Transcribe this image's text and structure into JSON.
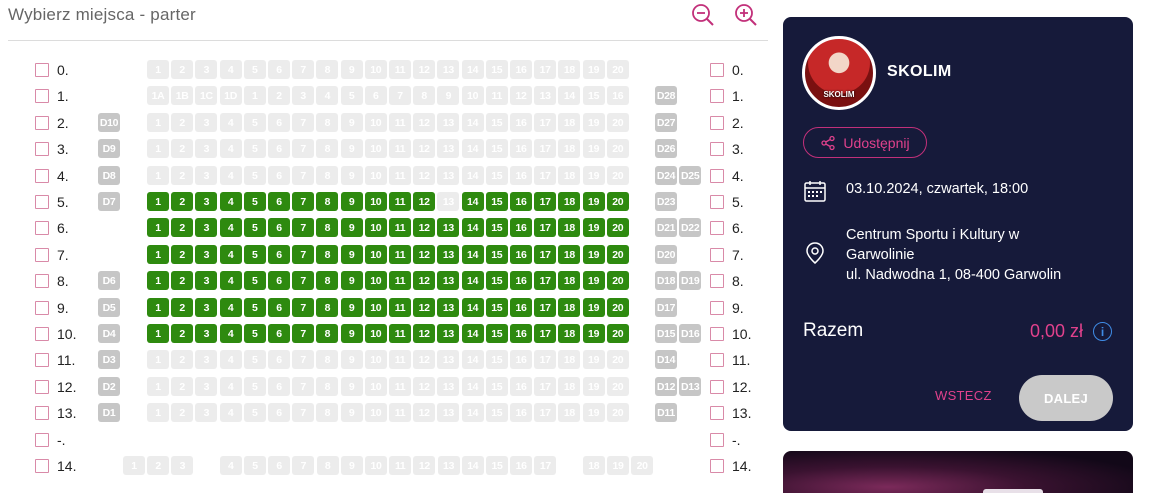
{
  "header": {
    "title": "Wybierz miejsca - parter",
    "zoom_out_icon": "zoom-out-icon",
    "zoom_in_icon": "zoom-in-icon",
    "accent": "#c2307a"
  },
  "seat_colors": {
    "free": "#ececec",
    "available": "#2e8a0f",
    "disabled": "#c6c6c6"
  },
  "rows": [
    {
      "label": "0.",
      "labelRight": "0.",
      "left": [],
      "seats": [
        "1",
        "2",
        "3",
        "4",
        "5",
        "6",
        "7",
        "8",
        "9",
        "10",
        "11",
        "12",
        "13",
        "14",
        "15",
        "16",
        "17",
        "18",
        "19",
        "20"
      ],
      "status": "free",
      "right": []
    },
    {
      "label": "1.",
      "labelRight": "1.",
      "left": [],
      "seats": [
        "1A",
        "1B",
        "1C",
        "1D",
        "1",
        "2",
        "3",
        "4",
        "5",
        "6",
        "7",
        "8",
        "9",
        "10",
        "11",
        "12",
        "13",
        "14",
        "15",
        "16"
      ],
      "status": "free",
      "right": [
        "D28"
      ]
    },
    {
      "label": "2.",
      "labelRight": "2.",
      "left": [
        "D10"
      ],
      "seats": [
        "1",
        "2",
        "3",
        "4",
        "5",
        "6",
        "7",
        "8",
        "9",
        "10",
        "11",
        "12",
        "13",
        "14",
        "15",
        "16",
        "17",
        "18",
        "19",
        "20"
      ],
      "status": "free",
      "right": [
        "D27"
      ]
    },
    {
      "label": "3.",
      "labelRight": "3.",
      "left": [
        "D9"
      ],
      "seats": [
        "1",
        "2",
        "3",
        "4",
        "5",
        "6",
        "7",
        "8",
        "9",
        "10",
        "11",
        "12",
        "13",
        "14",
        "15",
        "16",
        "17",
        "18",
        "19",
        "20"
      ],
      "status": "free",
      "right": [
        "D26"
      ]
    },
    {
      "label": "4.",
      "labelRight": "4.",
      "left": [
        "D8"
      ],
      "seats": [
        "1",
        "2",
        "3",
        "4",
        "5",
        "6",
        "7",
        "8",
        "9",
        "10",
        "11",
        "12",
        "13",
        "14",
        "15",
        "16",
        "17",
        "18",
        "19",
        "20"
      ],
      "status": "free",
      "right": [
        "D24",
        "D25"
      ]
    },
    {
      "label": "5.",
      "labelRight": "5.",
      "left": [
        "D7"
      ],
      "seats": [
        "1",
        "2",
        "3",
        "4",
        "5",
        "6",
        "7",
        "8",
        "9",
        "10",
        "11",
        "12",
        "13",
        "14",
        "15",
        "16",
        "17",
        "18",
        "19",
        "20"
      ],
      "status": "avail",
      "freeSeats": [
        "13"
      ],
      "right": [
        "D23"
      ]
    },
    {
      "label": "6.",
      "labelRight": "6.",
      "left": [],
      "seats": [
        "1",
        "2",
        "3",
        "4",
        "5",
        "6",
        "7",
        "8",
        "9",
        "10",
        "11",
        "12",
        "13",
        "14",
        "15",
        "16",
        "17",
        "18",
        "19",
        "20"
      ],
      "status": "avail",
      "right": [
        "D21",
        "D22"
      ]
    },
    {
      "label": "7.",
      "labelRight": "7.",
      "left": [],
      "seats": [
        "1",
        "2",
        "3",
        "4",
        "5",
        "6",
        "7",
        "8",
        "9",
        "10",
        "11",
        "12",
        "13",
        "14",
        "15",
        "16",
        "17",
        "18",
        "19",
        "20"
      ],
      "status": "avail",
      "right": [
        "D20"
      ]
    },
    {
      "label": "8.",
      "labelRight": "8.",
      "left": [
        "D6"
      ],
      "seats": [
        "1",
        "2",
        "3",
        "4",
        "5",
        "6",
        "7",
        "8",
        "9",
        "10",
        "11",
        "12",
        "13",
        "14",
        "15",
        "16",
        "17",
        "18",
        "19",
        "20"
      ],
      "status": "avail",
      "right": [
        "D18",
        "D19"
      ]
    },
    {
      "label": "9.",
      "labelRight": "9.",
      "left": [
        "D5"
      ],
      "seats": [
        "1",
        "2",
        "3",
        "4",
        "5",
        "6",
        "7",
        "8",
        "9",
        "10",
        "11",
        "12",
        "13",
        "14",
        "15",
        "16",
        "17",
        "18",
        "19",
        "20"
      ],
      "status": "avail",
      "right": [
        "D17"
      ]
    },
    {
      "label": "10.",
      "labelRight": "10.",
      "left": [
        "D4"
      ],
      "seats": [
        "1",
        "2",
        "3",
        "4",
        "5",
        "6",
        "7",
        "8",
        "9",
        "10",
        "11",
        "12",
        "13",
        "14",
        "15",
        "16",
        "17",
        "18",
        "19",
        "20"
      ],
      "status": "avail",
      "right": [
        "D15",
        "D16"
      ]
    },
    {
      "label": "11.",
      "labelRight": "11.",
      "left": [
        "D3"
      ],
      "seats": [
        "1",
        "2",
        "3",
        "4",
        "5",
        "6",
        "7",
        "8",
        "9",
        "10",
        "11",
        "12",
        "13",
        "14",
        "15",
        "16",
        "17",
        "18",
        "19",
        "20"
      ],
      "status": "free",
      "right": [
        "D14"
      ]
    },
    {
      "label": "12.",
      "labelRight": "12.",
      "left": [
        "D2"
      ],
      "seats": [
        "1",
        "2",
        "3",
        "4",
        "5",
        "6",
        "7",
        "8",
        "9",
        "10",
        "11",
        "12",
        "13",
        "14",
        "15",
        "16",
        "17",
        "18",
        "19",
        "20"
      ],
      "status": "free",
      "right": [
        "D12",
        "D13"
      ]
    },
    {
      "label": "13.",
      "labelRight": "13.",
      "left": [
        "D1"
      ],
      "seats": [
        "1",
        "2",
        "3",
        "4",
        "5",
        "6",
        "7",
        "8",
        "9",
        "10",
        "11",
        "12",
        "13",
        "14",
        "15",
        "16",
        "17",
        "18",
        "19",
        "20"
      ],
      "status": "free",
      "right": [
        "D11"
      ]
    },
    {
      "label": "-.",
      "labelRight": "-.",
      "left": [],
      "seats": [],
      "status": "free",
      "right": []
    },
    {
      "label": "14.",
      "labelRight": "14.",
      "left": [],
      "seats": [
        "1",
        "2",
        "3",
        "",
        "4",
        "5",
        "6",
        "7",
        "8",
        "9",
        "10",
        "11",
        "12",
        "13",
        "14",
        "15",
        "16",
        "17",
        "",
        "18",
        "19",
        "20"
      ],
      "status": "free",
      "right": [],
      "special": true
    }
  ],
  "panel": {
    "artist": "SKOLIM",
    "avatar_caption": "SKOLIM",
    "share_label": "Udostępnij",
    "date": "03.10.2024, czwartek, 18:00",
    "venue_line1": "Centrum Sportu i Kultury w",
    "venue_line2": "Garwolinie",
    "venue_line3": "ul. Nadwodna 1, 08-400 Garwolin",
    "total_label": "Razem",
    "total_value": "0,00 zł",
    "info_glyph": "i",
    "back_label": "WSTECZ",
    "next_label": "DALEJ",
    "panel_color": "#161a3a",
    "accent": "#e0418c"
  }
}
